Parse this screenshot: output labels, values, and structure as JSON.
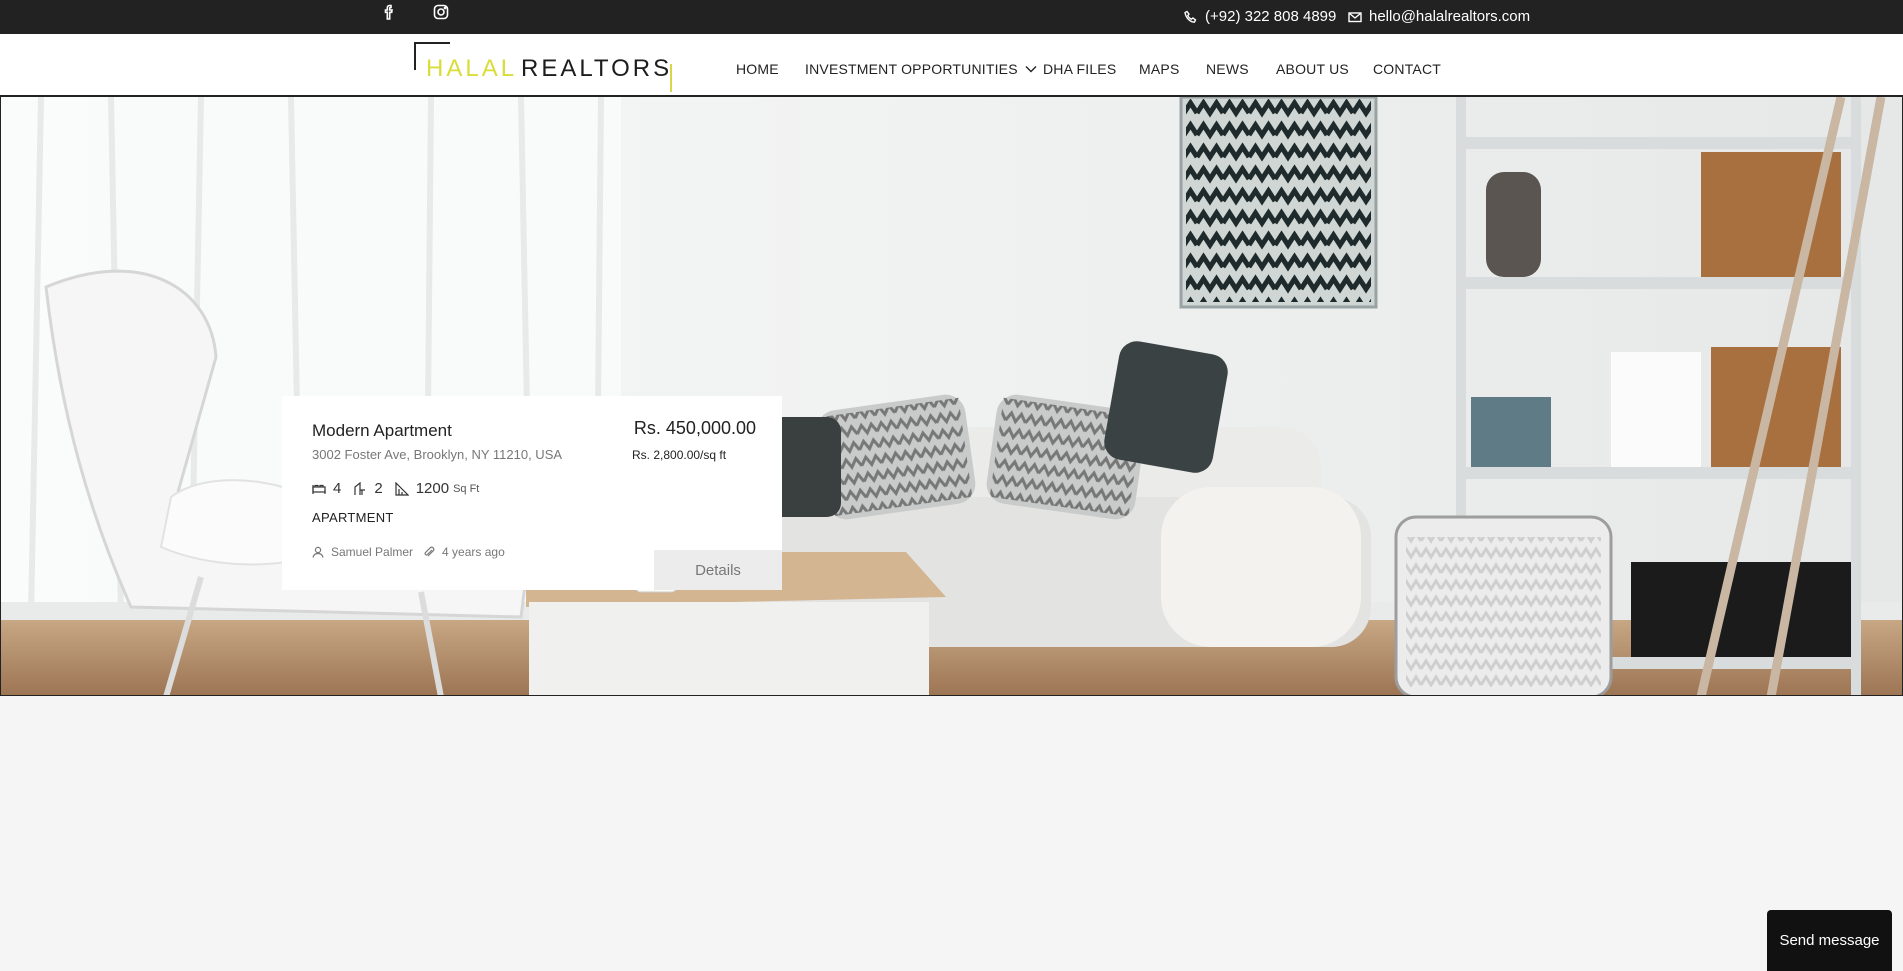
{
  "topbar": {
    "social": [
      {
        "icon": "facebook-icon"
      },
      {
        "icon": "instagram-icon"
      }
    ],
    "phone": "(+92) 322 808 4899",
    "email": "hello@halalrealtors.com"
  },
  "logo": {
    "word1": "HALAL",
    "word2": "REALTORS"
  },
  "nav": {
    "home": "HOME",
    "investment": "INVESTMENT OPPORTUNITIES",
    "dha_files": "DHA FILES",
    "maps": "MAPS",
    "news": "NEWS",
    "about": "ABOUT US",
    "contact": "CONTACT"
  },
  "listing": {
    "title": "Modern Apartment",
    "address": "3002 Foster Ave, Brooklyn, NY 11210, USA",
    "price": "Rs. 450,000.00",
    "price_per_sqft": "Rs. 2,800.00/sq ft",
    "beds": "4",
    "baths": "2",
    "area": "1200",
    "area_unit": "Sq Ft",
    "type": "APARTMENT",
    "agent": "Samuel Palmer",
    "posted": "4 years ago",
    "details_label": "Details"
  },
  "colors": {
    "topbar_bg": "#222222",
    "logo_accent": "#d9dd39",
    "page_bg": "#f5f5f5"
  },
  "chat": {
    "label": "Send message"
  }
}
